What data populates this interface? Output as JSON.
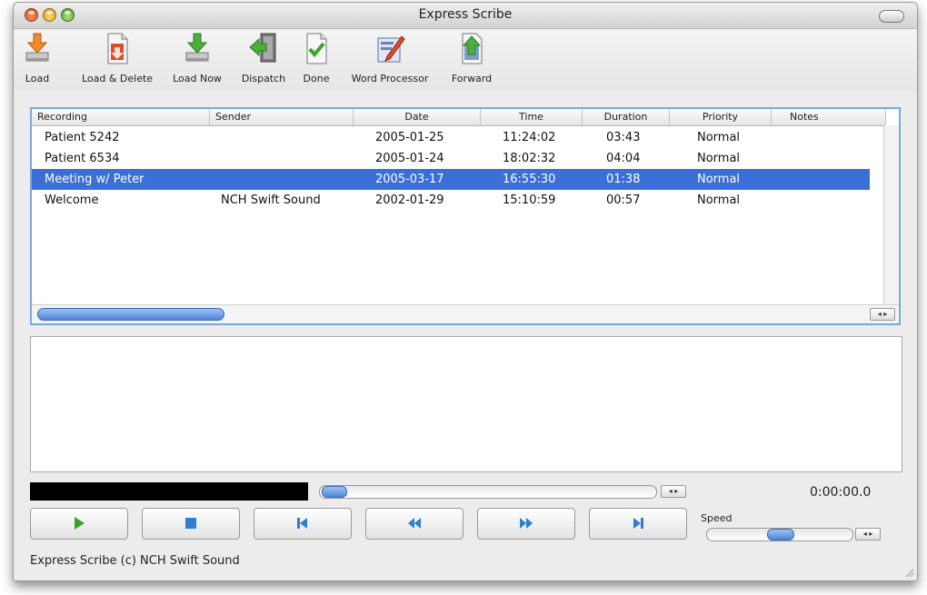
{
  "window": {
    "title": "Express Scribe"
  },
  "toolbar": {
    "buttons": [
      {
        "label": "Load",
        "icon": "load-icon"
      },
      {
        "label": "Load & Delete",
        "icon": "load-delete-icon"
      },
      {
        "label": "Load Now",
        "icon": "load-now-icon"
      },
      {
        "label": "Dispatch",
        "icon": "dispatch-icon"
      },
      {
        "label": "Done",
        "icon": "done-icon"
      },
      {
        "label": "Word Processor",
        "icon": "word-processor-icon"
      },
      {
        "label": "Forward",
        "icon": "forward-icon"
      }
    ]
  },
  "list": {
    "columns": [
      "Recording",
      "Sender",
      "Date",
      "Time",
      "Duration",
      "Priority",
      "Notes"
    ],
    "rows": [
      {
        "recording": "Patient 5242",
        "sender": "",
        "date": "2005-01-25",
        "time": "11:24:02",
        "duration": "03:43",
        "priority": "Normal",
        "notes": ""
      },
      {
        "recording": "Patient 6534",
        "sender": "",
        "date": "2005-01-24",
        "time": "18:02:32",
        "duration": "04:04",
        "priority": "Normal",
        "notes": ""
      },
      {
        "recording": "Meeting w/ Peter",
        "sender": "",
        "date": "2005-03-17",
        "time": "16:55:30",
        "duration": "01:38",
        "priority": "Normal",
        "notes": ""
      },
      {
        "recording": "Welcome",
        "sender": "NCH Swift Sound",
        "date": "2002-01-29",
        "time": "15:10:59",
        "duration": "00:57",
        "priority": "Normal",
        "notes": ""
      }
    ],
    "selected_index": 2
  },
  "playback": {
    "time": "0:00:00.0",
    "position_fraction": 0.0,
    "speed_label": "Speed",
    "speed_fraction": 0.5,
    "buttons": [
      "play-icon",
      "stop-icon",
      "skip-to-start-icon",
      "rewind-icon",
      "fast-forward-icon",
      "skip-to-end-icon"
    ]
  },
  "status": {
    "text": "Express Scribe (c) NCH Swift Sound"
  },
  "colors": {
    "selection": "#3a6fd8",
    "focus_ring": "#7aa7e0",
    "transport_glyph": "#2f7fd0",
    "play_glyph": "#3aa32a"
  }
}
